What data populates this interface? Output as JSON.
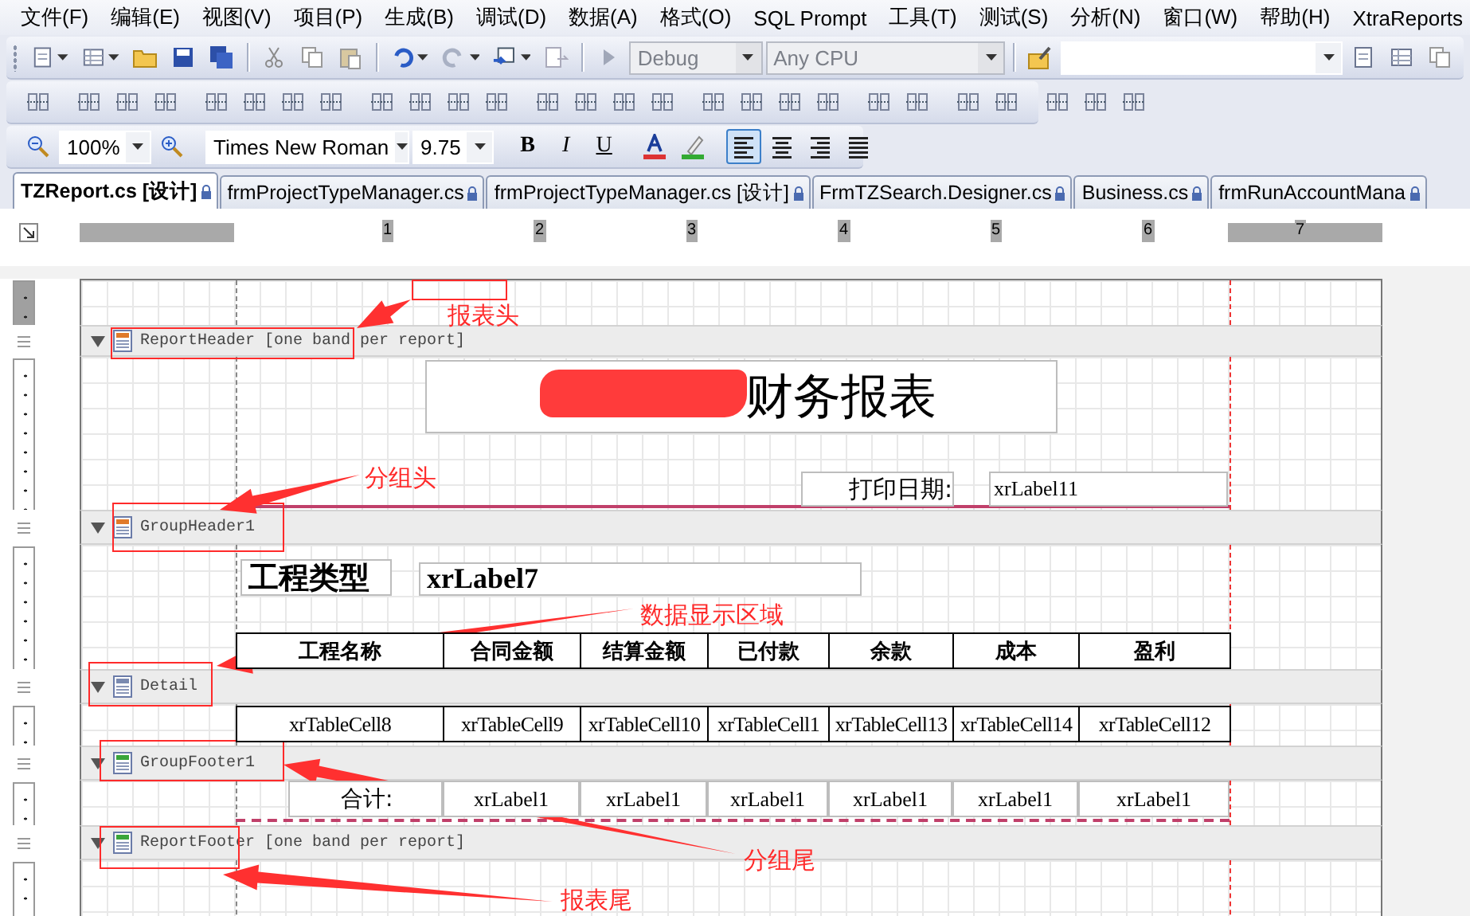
{
  "menu": [
    "文件(F)",
    "编辑(E)",
    "视图(V)",
    "项目(P)",
    "生成(B)",
    "调试(D)",
    "数据(A)",
    "格式(O)",
    "SQL Prompt",
    "工具(T)",
    "测试(S)",
    "分析(N)",
    "窗口(W)",
    "帮助(H)",
    "XtraReports"
  ],
  "toolbar_build": {
    "combos": [
      {
        "value": "Debug",
        "disabled": true
      },
      {
        "value": "Any CPU",
        "disabled": true
      }
    ]
  },
  "toolbar_format": {
    "zoom": "100%",
    "font": "Times New Roman",
    "size": "9.75",
    "style_buttons": [
      {
        "label": "B",
        "kind": "bold"
      },
      {
        "label": "I",
        "kind": "italic"
      },
      {
        "label": "U",
        "kind": "underline"
      }
    ],
    "alignment": [
      {
        "kind": "left",
        "selected": true
      },
      {
        "kind": "center",
        "selected": false
      },
      {
        "kind": "right",
        "selected": false
      },
      {
        "kind": "justify",
        "selected": false
      }
    ]
  },
  "tabs": [
    {
      "label": "TZReport.cs [设计]",
      "selected": true
    },
    {
      "label": "frmProjectTypeManager.cs",
      "selected": false
    },
    {
      "label": "frmProjectTypeManager.cs [设计]",
      "selected": false
    },
    {
      "label": "FrmTZSearch.Designer.cs",
      "selected": false
    },
    {
      "label": "Business.cs",
      "selected": false
    },
    {
      "label": "frmRunAccountMana",
      "selected": false
    }
  ],
  "ruler": {
    "labels": [
      "1",
      "2",
      "3",
      "4",
      "5",
      "6",
      "7"
    ]
  },
  "bands": [
    {
      "kind": "report_header",
      "caption": "ReportHeader [one band per report]",
      "title": "财务报表",
      "date_label": "打印日期:",
      "date_value": "xrLabel11"
    },
    {
      "kind": "group_header",
      "caption": "GroupHeader1",
      "group_label": "工程类型",
      "group_value": "xrLabel7",
      "columns": [
        "工程名称",
        "合同金额",
        "结算金额",
        "已付款",
        "余款",
        "成本",
        "盈利"
      ]
    },
    {
      "kind": "detail",
      "caption": "Detail",
      "cells": [
        "xrTableCell8",
        "xrTableCell9",
        "xrTableCell10",
        "xrTableCell1",
        "xrTableCell13",
        "xrTableCell14",
        "xrTableCell12"
      ]
    },
    {
      "kind": "group_footer",
      "caption": "GroupFooter1",
      "total_label": "合计:",
      "totals": [
        "xrLabel1",
        "xrLabel1",
        "xrLabel1",
        "xrLabel1",
        "xrLabel1",
        "xrLabel1"
      ]
    },
    {
      "kind": "report_footer",
      "caption": "ReportFooter [one band per report]"
    }
  ],
  "annotations": [
    {
      "text": "报表头"
    },
    {
      "text": "分组头"
    },
    {
      "text": "数据显示区域"
    },
    {
      "text": "分组尾"
    },
    {
      "text": "报表尾"
    }
  ]
}
